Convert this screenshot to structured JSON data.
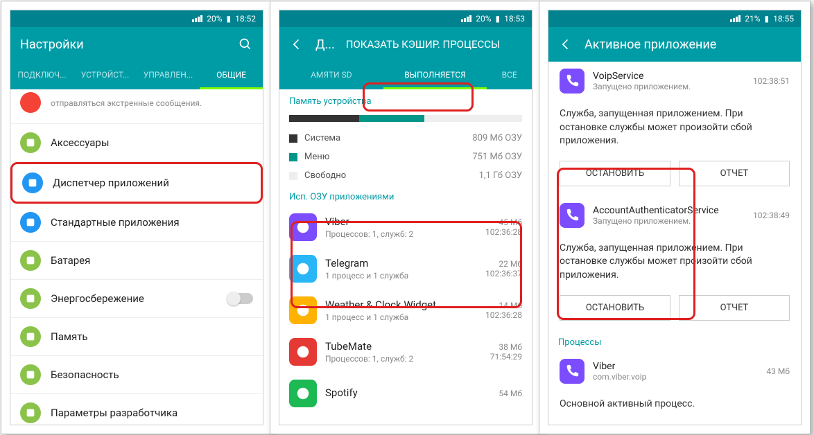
{
  "screen1": {
    "status": {
      "signal_pct": "20%",
      "time": "18:52"
    },
    "title": "Настройки",
    "tabs": [
      "ПОДКЛЮЧ...",
      "УСТРОЙСТ...",
      "УПРАВЛЕН...",
      "ОБЩИЕ"
    ],
    "active_tab_index": 3,
    "partial_top": "отправляться экстренные сообщения.",
    "items": [
      {
        "label": "Аксессуары",
        "color": "#8bc34a"
      },
      {
        "label": "Диспетчер приложений",
        "color": "#2196f3",
        "highlight": true
      },
      {
        "label": "Стандартные приложения",
        "color": "#2196f3"
      },
      {
        "label": "Батарея",
        "color": "#8bc34a"
      },
      {
        "label": "Энергосбережение",
        "color": "#8bc34a",
        "toggle": true
      },
      {
        "label": "Память",
        "color": "#8bc34a"
      },
      {
        "label": "Безопасность",
        "color": "#8bc34a"
      },
      {
        "label": "Параметры разработчика",
        "color": "#8bc34a"
      }
    ]
  },
  "screen2": {
    "status": {
      "signal_pct": "20%",
      "time": "18:53"
    },
    "title": "ПОКАЗАТЬ КЭШИР. ПРОЦЕССЫ",
    "back_label": "Д...",
    "tabs": [
      "АМЯТИ SD",
      "ВЫПОЛНЯЕТСЯ",
      "ВСЕ"
    ],
    "active_tab_index": 1,
    "mem_header": "Память устройства",
    "mem": [
      {
        "label": "Система",
        "value": "809 Мб ОЗУ",
        "color": "#333"
      },
      {
        "label": "Меню",
        "value": "751 Мб ОЗУ",
        "color": "#009688"
      },
      {
        "label": "Свободно",
        "value": "1,1 Гб ОЗУ",
        "color": "#eee"
      }
    ],
    "apps_header": "Исп. ОЗУ приложениями",
    "apps": [
      {
        "name": "Viber",
        "sub": "Процессов: 1, служб: 2",
        "size": "45 Мб",
        "time": "102:36:28",
        "color": "#7c4dff"
      },
      {
        "name": "Telegram",
        "sub": "1 процесс и 1 служба",
        "size": "22 Мб",
        "time": "102:36:37",
        "color": "#29b6f6"
      },
      {
        "name": "Weather & Clock Widget",
        "sub": "1 процесс и 1 служба",
        "size": "14 Мб",
        "time": "102:36:28",
        "color": "#ffb300"
      },
      {
        "name": "TubeMate",
        "sub": "Процессов: 1, служб: 2",
        "size": "38 Мб",
        "time": "71:54:29",
        "color": "#e53935"
      },
      {
        "name": "Spotify",
        "sub": "",
        "size": "54 Мб",
        "time": "",
        "color": "#1db954"
      }
    ]
  },
  "screen3": {
    "status": {
      "signal_pct": "21%",
      "time": "18:55"
    },
    "title": "Активное приложение",
    "services": [
      {
        "name": "VoipService",
        "sub": "Запущено приложением.",
        "time": "102:38:51"
      },
      {
        "name": "AccountAuthenticatorService",
        "sub": "Запущено приложением.",
        "time": "102:38:49"
      }
    ],
    "desc": "Служба, запущенная приложением. При остановке службы может произойти сбой приложения.",
    "btn_stop": "ОСТАНОВИТЬ",
    "btn_report": "ОТЧЕТ",
    "proc_header": "Процессы",
    "proc": {
      "name": "Viber",
      "sub": "com.viber.voip",
      "size": "43 Мб"
    },
    "footer": "Основной активный процесс."
  }
}
